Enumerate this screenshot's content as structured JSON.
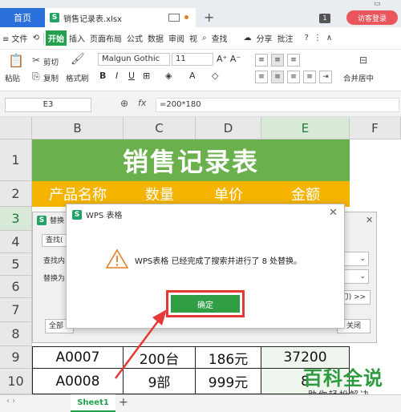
{
  "tabs": {
    "home": "首页",
    "doc": "销售记录表.xlsx",
    "badge": "1",
    "visitor": "访客登录"
  },
  "menu": {
    "items": [
      "≡ 文件",
      "开始",
      "插入",
      "页面布局",
      "公式",
      "数据",
      "审阅",
      "视",
      "查找",
      "分享",
      "批注"
    ],
    "start": "开始"
  },
  "ribbon": {
    "paste": "粘贴",
    "cut": "剪切",
    "copy": "复制",
    "format_painter": "格式刷",
    "font_name": "Malgun Gothic",
    "font_size": "11",
    "merge": "合并居中"
  },
  "formula_bar": {
    "cell_ref": "E3",
    "formula": "=200*180"
  },
  "columns": [
    "B",
    "C",
    "D",
    "E",
    "F"
  ],
  "rows": [
    "1",
    "2",
    "3",
    "4",
    "5",
    "6",
    "7",
    "8",
    "9",
    "10"
  ],
  "sheet": {
    "title": "销售记录表",
    "headers": [
      "产品名称",
      "数量",
      "单价",
      "金额"
    ],
    "row9": [
      "A0007",
      "200台",
      "186元",
      "37200"
    ],
    "row10": [
      "A0008",
      "9部",
      "999元",
      "8"
    ]
  },
  "find_replace": {
    "title": "替换",
    "tab": "查找(",
    "find_label": "查找内",
    "replace_label": "替换为",
    "all": "全部",
    "more": "刀) >>",
    "close": "关闭"
  },
  "modal": {
    "title": "WPS 表格",
    "message": "WPS表格 已经完成了搜索并进行了 8 处替换。",
    "ok": "确定"
  },
  "watermark": {
    "title": "百科全说",
    "subtitle": "助你轻松解决"
  },
  "sheet_tab": "Sheet1",
  "colors": {
    "title_green": "#6ab04c",
    "header_yellow": "#f4b400",
    "ok_green": "#2f9e44",
    "highlight_red": "#e53935"
  }
}
